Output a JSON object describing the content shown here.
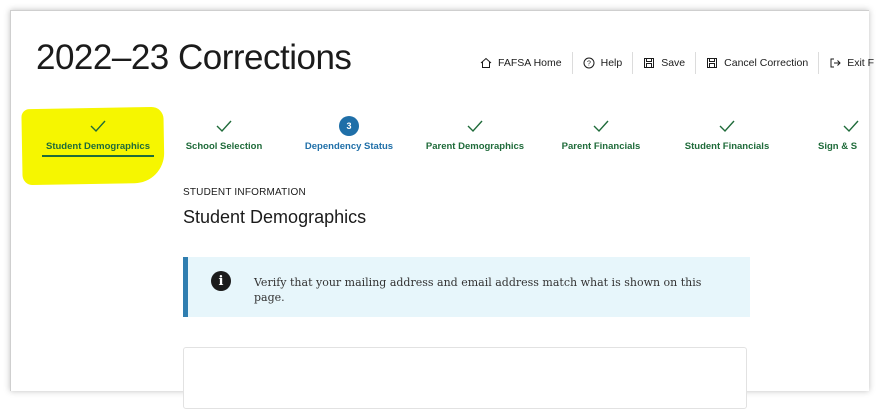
{
  "page": {
    "title": "2022–23 Corrections"
  },
  "toplinks": [
    {
      "label": "FAFSA Home",
      "icon": "home-icon"
    },
    {
      "label": "Help",
      "icon": "help-icon"
    },
    {
      "label": "Save",
      "icon": "save-icon"
    },
    {
      "label": "Cancel Correction",
      "icon": "cancel-icon"
    },
    {
      "label": "Exit F",
      "icon": "exit-icon"
    }
  ],
  "steps": [
    {
      "label": "Student Demographics",
      "state": "complete",
      "active": true
    },
    {
      "label": "School Selection",
      "state": "complete"
    },
    {
      "label": "Dependency Status",
      "state": "current",
      "number": "3"
    },
    {
      "label": "Parent Demographics",
      "state": "complete"
    },
    {
      "label": "Parent Financials",
      "state": "complete"
    },
    {
      "label": "Student Financials",
      "state": "complete"
    },
    {
      "label": "Sign & S",
      "state": "complete"
    }
  ],
  "section": {
    "eyebrow": "STUDENT INFORMATION",
    "title": "Student Demographics"
  },
  "alert": {
    "icon": "info-icon",
    "message": "Verify that your mailing address and email address match what is shown on this page."
  },
  "colors": {
    "complete": "#1f6b3a",
    "current": "#1f6fa8",
    "highlight": "#f6f600",
    "alert_bg": "#e7f6fb",
    "alert_border": "#2f7eb0"
  }
}
